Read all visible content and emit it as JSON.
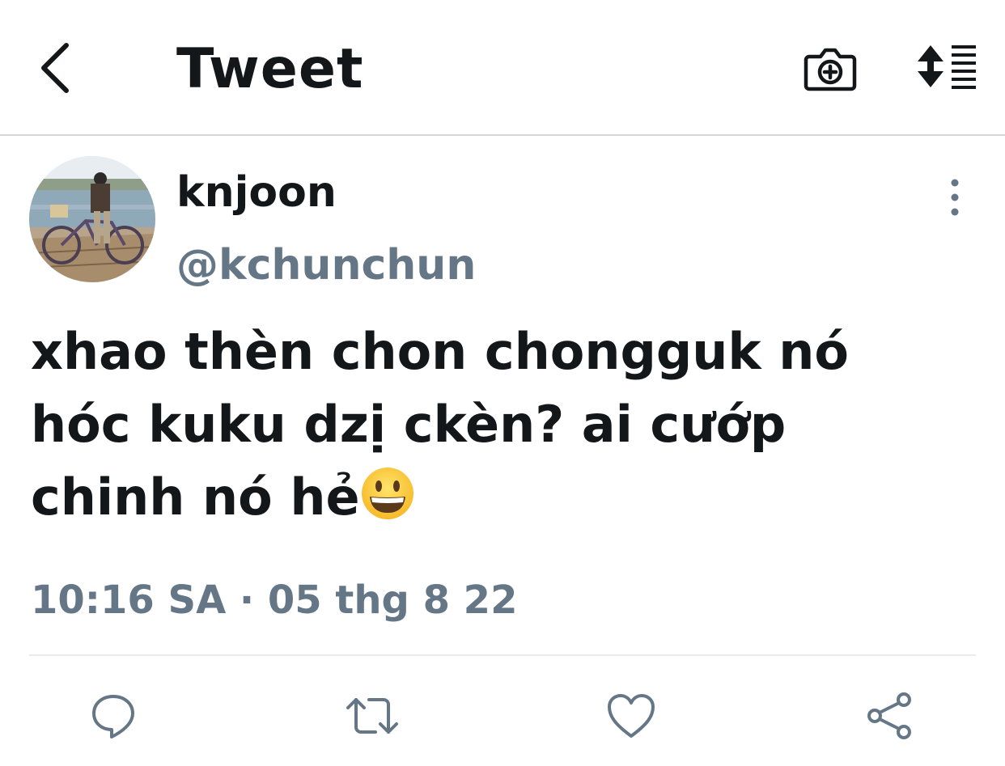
{
  "header": {
    "title": "Tweet",
    "back_icon": "chevron-left-icon",
    "camera_icon": "camera-add-icon",
    "sort_icon": "sort-list-icon"
  },
  "tweet": {
    "author_name": "knjoon",
    "author_handle": "@kchunchun",
    "text": "xhao thèn chon chongguk nó\nhóc kuku dzị ckèn? ai cướp\nchinh nó hẻ",
    "emoji": "grinning-face-emoji",
    "timestamp": "10:16 SA · 05 thg 8 22"
  },
  "actions": {
    "reply_icon": "reply-icon",
    "retweet_icon": "retweet-icon",
    "like_icon": "heart-icon",
    "share_icon": "share-icon"
  },
  "colors": {
    "text_primary": "#14171a",
    "text_secondary": "#657786",
    "icon": "#657786",
    "divider": "#e6ecf0"
  }
}
